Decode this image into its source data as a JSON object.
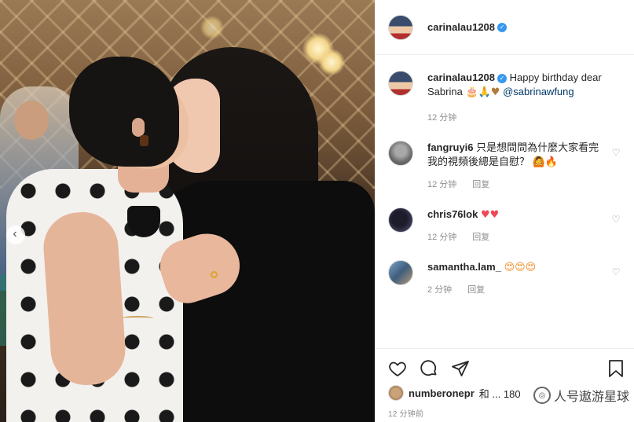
{
  "post": {
    "author": "carinalau1208",
    "verified": true,
    "caption": {
      "username": "carinalau1208",
      "text": "Happy birthday dear Sabrina",
      "emojis": "🎂🙏♥",
      "mention": "@sabrinawfung",
      "time": "12 分钟"
    }
  },
  "comments": [
    {
      "username": "fangruyi6",
      "text": "只是想問問為什麼大家看完我的視頻後總是自慰？",
      "emojis": "🙆🔥",
      "time": "12 分钟",
      "reply": "回复"
    },
    {
      "username": "chris76lok",
      "text": "",
      "emojis": "♥♥",
      "time": "12 分钟",
      "reply": "回复"
    },
    {
      "username": "samantha.lam_",
      "text": "",
      "emojis": "😍😍😍",
      "time": "2 分钟",
      "reply": "回复"
    }
  ],
  "likes": {
    "username": "numberonepr",
    "rest": "和 ... 180"
  },
  "posted_time": "12 分钟前",
  "watermark": "人号遨游星球",
  "icons": {
    "like": "heart-icon",
    "comment": "comment-bubble-icon",
    "share": "paper-plane-icon",
    "save": "bookmark-icon",
    "prev": "chevron-left-icon",
    "verified": "verified-badge-icon"
  },
  "colors": {
    "verified": "#3897f0",
    "heart": "#ed4956",
    "meta": "#8e8e8e",
    "mention": "#00376b"
  }
}
